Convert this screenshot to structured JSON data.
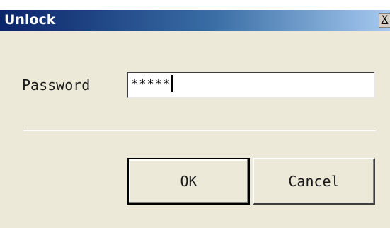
{
  "window": {
    "title": "Unlock",
    "close_label": "X"
  },
  "form": {
    "password_label": "Password",
    "password_value": "*****"
  },
  "buttons": {
    "ok_label": "OK",
    "cancel_label": "Cancel"
  },
  "colors": {
    "titlebar_start": "#0a246a",
    "titlebar_end": "#a6caf0",
    "dialog_background": "#ece9d8"
  },
  "icons": {
    "close": "close-icon"
  }
}
